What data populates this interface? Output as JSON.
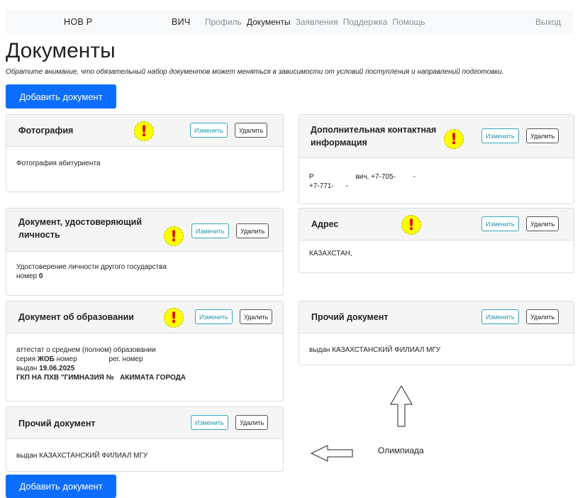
{
  "navbar": {
    "user_name_part1": "НОВ Р",
    "user_name_part2": "ВИЧ",
    "nav_items": [
      "Профиль",
      "Документы",
      "Заявления",
      "Поддержка",
      "Помощь"
    ],
    "active_item": "Документы",
    "logout": "Выход"
  },
  "page": {
    "title": "Документы",
    "notice": "Обратите внимание, что обязательный набор документов может меняться в зависимости от условий поступления и направлений подготовки.",
    "add_button": "Добавить документ"
  },
  "cards": {
    "photo": {
      "title": "Фотография",
      "edit": "Изменить",
      "delete": "Удалить",
      "body": "Фотография абитуриента"
    },
    "contact": {
      "title_line1": "Дополнительная контактная",
      "title_line2": "информация",
      "edit": "Изменить",
      "delete": "Удалить",
      "line1_a": "Р",
      "line1_b": "вич, +7-705-",
      "line1_c": "-",
      "line2": "+7-771-      -"
    },
    "identity": {
      "title_line1": "Документ, удостоверяющий",
      "title_line2": "личность",
      "edit": "Изменить",
      "delete": "Удалить",
      "line1": "Удостоверение личности другого государства",
      "line2_label": "номер",
      "line2_value": "0"
    },
    "address": {
      "title": "Адрес",
      "edit": "Изменить",
      "delete": "Удалить",
      "body": "КАЗАХСТАН,"
    },
    "education": {
      "title": "Документ об образовании",
      "edit": "Изменить",
      "delete": "Удалить",
      "line1": "аттестат о среднем (полном) образовании",
      "series_label": "серия",
      "series_value": "ЖОБ",
      "number_label": "номер",
      "reg_label": "рег. номер",
      "issued_label": "выдан",
      "issued_date": "19.06.2025",
      "school": "ГКП НА ПХВ \"ГИМНАЗИЯ №   АКИМАТА ГОРОДА"
    },
    "other_right": {
      "title": "Прочий документ",
      "edit": "Изменить",
      "delete": "Удалить",
      "body": "выдан КАЗАХСТАНСКИЙ ФИЛИАЛ МГУ"
    },
    "other_left": {
      "title": "Прочий документ",
      "edit": "Изменить",
      "delete": "Удалить",
      "body": "выдан КАЗАХСТАНСКИЙ ФИЛИАЛ МГУ"
    }
  },
  "annotations": {
    "warning_icon": "exclamation-mark-icon",
    "warning_color": "#ffff00",
    "olympiad_label": "Олимпиада"
  },
  "colors": {
    "primary": "#0d6efd",
    "edit_border": "#35a7bd",
    "header_bg": "#f5f5f5"
  }
}
